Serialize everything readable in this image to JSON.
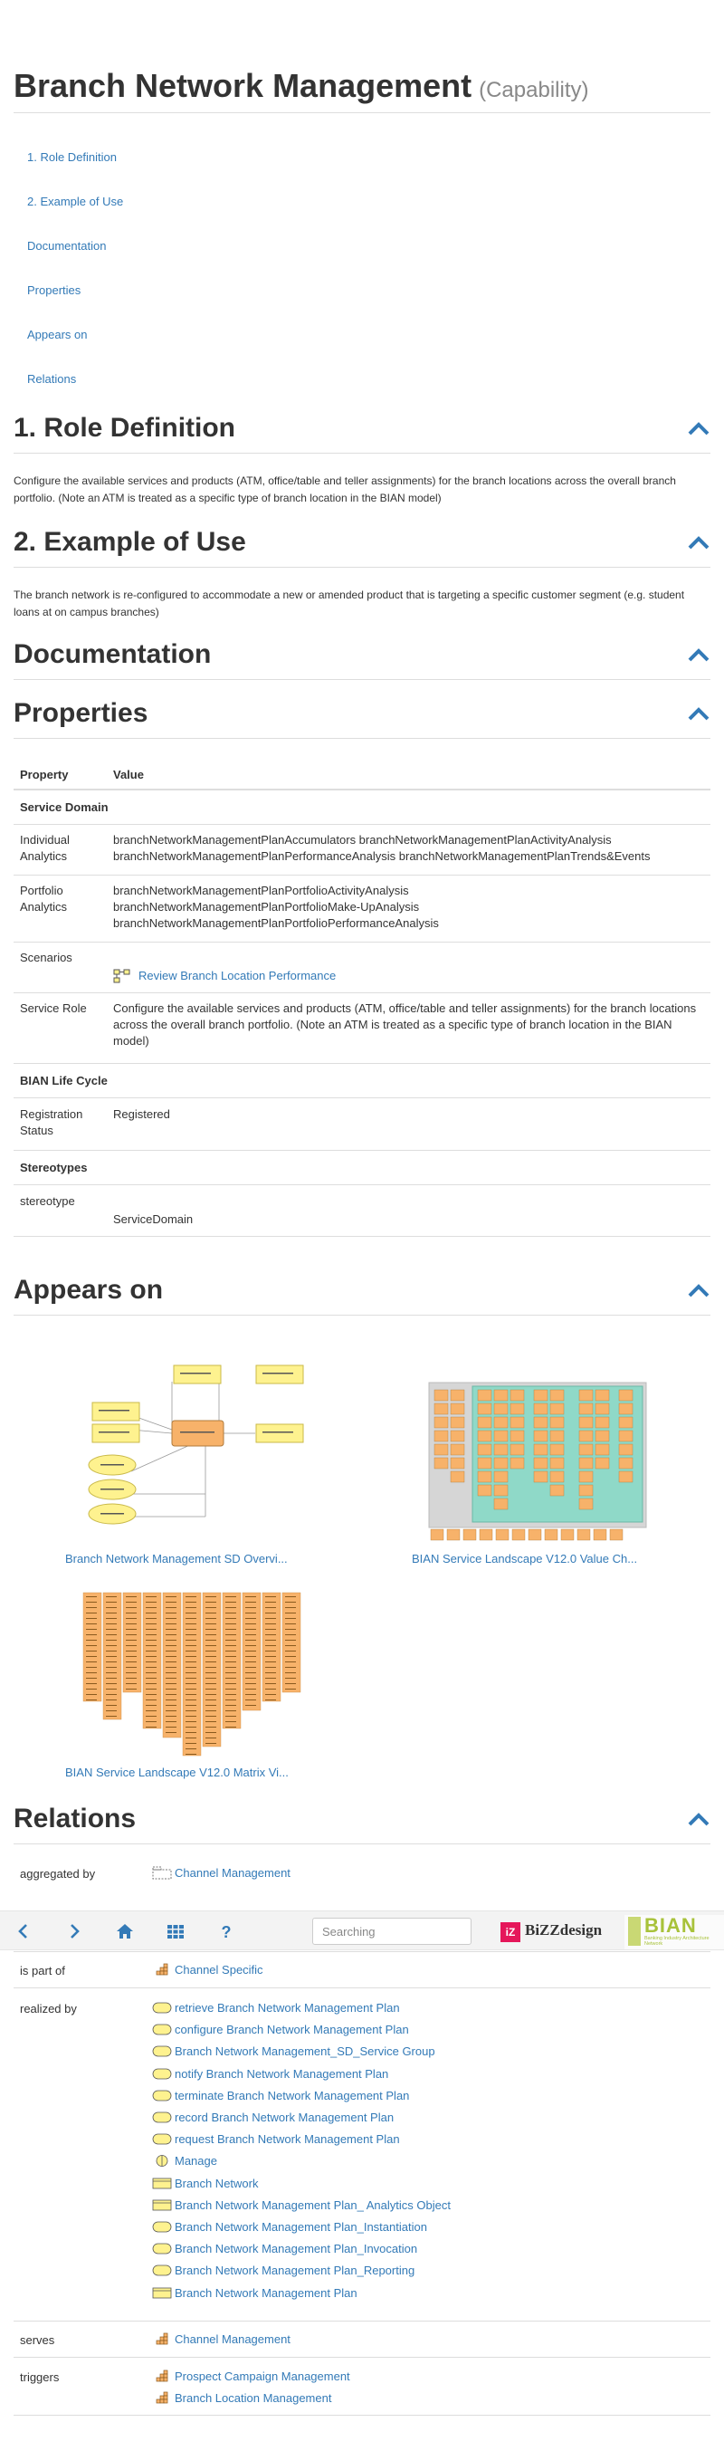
{
  "page": {
    "title": "Branch Network Management",
    "title_suffix": "(Capability)"
  },
  "toc": [
    {
      "label": "1. Role Definition"
    },
    {
      "label": "2. Example of Use"
    },
    {
      "label": "Documentation"
    },
    {
      "label": "Properties"
    },
    {
      "label": "Appears on"
    },
    {
      "label": "Relations"
    }
  ],
  "sections": {
    "role": {
      "heading": "1. Role Definition",
      "text": "Configure the available services and products (ATM, office/table and teller assignments) for the branch locations across the overall branch portfolio. (Note an ATM is treated as a specific type of branch location in the BIAN model)"
    },
    "example": {
      "heading": "2. Example of Use",
      "text": "The branch network is re-configured to accommodate a new or amended product that is targeting a specific customer segment (e.g. student loans at on campus branches)"
    },
    "documentation": {
      "heading": "Documentation"
    },
    "properties": {
      "heading": "Properties"
    },
    "appears": {
      "heading": "Appears on"
    },
    "relations": {
      "heading": "Relations"
    }
  },
  "properties": {
    "col_property": "Property",
    "col_value": "Value",
    "group_service_domain": "Service Domain",
    "individual_label": "Individual Analytics",
    "individual_line1": "branchNetworkManagementPlanAccumulators branchNetworkManagementPlanActivityAnalysis",
    "individual_line2": "branchNetworkManagementPlanPerformanceAnalysis branchNetworkManagementPlanTrends&Events",
    "portfolio_label": "Portfolio Analytics",
    "portfolio_line1": "branchNetworkManagementPlanPortfolioActivityAnalysis",
    "portfolio_line2": "branchNetworkManagementPlanPortfolioMake-UpAnalysis",
    "portfolio_line3": "branchNetworkManagementPlanPortfolioPerformanceAnalysis",
    "scenarios_label": "Scenarios",
    "scenarios_link": "Review Branch Location Performance",
    "service_role_label": "Service Role",
    "service_role_text": "Configure the available services and products (ATM, office/table and teller assignments) for the branch locations across the overall branch portfolio. (Note an ATM is treated as a specific type of branch location in the BIAN model)",
    "group_lifecycle": "BIAN Life Cycle",
    "registration_label": "Registration Status",
    "registration_value": "Registered",
    "group_stereotypes": "Stereotypes",
    "stereotype_label": "stereotype",
    "stereotype_value": "ServiceDomain"
  },
  "appears_on": [
    {
      "caption": "Branch Network Management SD Overvi..."
    },
    {
      "caption": "BIAN Service Landscape V12.0 Value Ch..."
    },
    {
      "caption": "BIAN Service Landscape V12.0 Matrix Vi..."
    }
  ],
  "relations": {
    "aggregated_by_label": "aggregated by",
    "aggregated_by": [
      "Channel Management"
    ],
    "is_part_of_label": "is part of",
    "is_part_of": [
      "Channel Specific"
    ],
    "realized_by_label": "realized by",
    "realized_by": [
      {
        "label": "retrieve Branch Network Management Plan",
        "icon": "service-icon"
      },
      {
        "label": "configure Branch Network Management Plan",
        "icon": "service-icon"
      },
      {
        "label": "Branch Network Management_SD_Service Group",
        "icon": "service-icon"
      },
      {
        "label": "notify Branch Network Management Plan",
        "icon": "service-icon"
      },
      {
        "label": "terminate Branch Network Management Plan",
        "icon": "service-icon"
      },
      {
        "label": "record Branch Network Management Plan",
        "icon": "service-icon"
      },
      {
        "label": "request Branch Network Management Plan",
        "icon": "service-icon"
      },
      {
        "label": "Manage",
        "icon": "interface-icon"
      },
      {
        "label": "Branch Network",
        "icon": "object-icon"
      },
      {
        "label": "Branch Network Management Plan_ Analytics Object",
        "icon": "object-icon"
      },
      {
        "label": "Branch Network Management Plan_Instantiation",
        "icon": "service-icon"
      },
      {
        "label": "Branch Network Management Plan_Invocation",
        "icon": "service-icon"
      },
      {
        "label": "Branch Network Management Plan_Reporting",
        "icon": "service-icon"
      },
      {
        "label": "Branch Network Management Plan",
        "icon": "object-icon"
      }
    ],
    "serves_label": "serves",
    "serves": [
      "Channel Management"
    ],
    "triggers_label": "triggers",
    "triggers": [
      "Prospect Campaign Management",
      "Branch Location Management"
    ]
  },
  "toolbar": {
    "search_placeholder": "Searching",
    "bizz_logo_text": "BiZZdesign",
    "bizz_mark": "iZ",
    "bian_logo_text": "BIAN",
    "bian_tagline": "Banking Industry Architecture Network"
  },
  "colors": {
    "link": "#337ab7",
    "capability_orange": "#f7b26a",
    "service_yellow": "#fef28f",
    "bizz_pink": "#e5175a",
    "bian_green": "#a8c23a"
  }
}
